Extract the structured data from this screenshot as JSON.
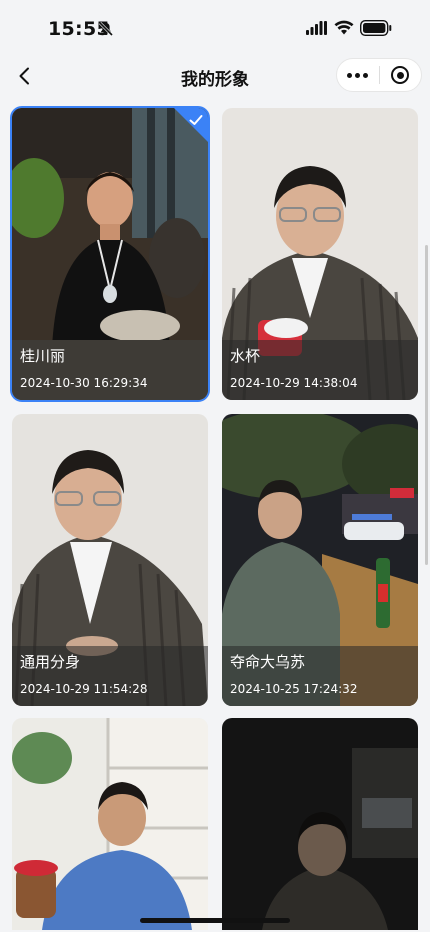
{
  "status": {
    "time": "15:55"
  },
  "nav": {
    "title": "我的形象"
  },
  "avatars": [
    {
      "name": "桂川丽",
      "time": "2024-10-30 16:29:34",
      "selected": true
    },
    {
      "name": "水杯",
      "time": "2024-10-29 14:38:04",
      "selected": false
    },
    {
      "name": "通用分身",
      "time": "2024-10-29 11:54:28",
      "selected": false
    },
    {
      "name": "夺命大乌苏",
      "time": "2024-10-25 17:24:32",
      "selected": false
    },
    {
      "name": "",
      "time": "",
      "selected": false
    },
    {
      "name": "",
      "time": "",
      "selected": false
    }
  ],
  "colors": {
    "accent": "#3b82f6",
    "background": "#f3f4f6"
  },
  "icons": [
    "bell-slash-icon",
    "signal-icon",
    "wifi-icon",
    "battery-icon",
    "back-icon",
    "more-icon",
    "close-mini-program-icon",
    "check-icon"
  ]
}
